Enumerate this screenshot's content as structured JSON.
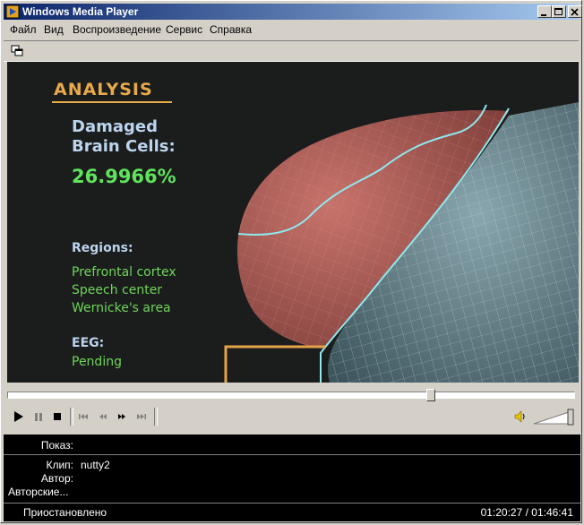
{
  "window": {
    "title": "Windows Media Player"
  },
  "menu": [
    "Файл",
    "Вид",
    "Воспроизведение",
    "Сервис",
    "Справка"
  ],
  "overlay": {
    "heading": "ANALYSIS",
    "damaged_line1": "Damaged",
    "damaged_line2": "Brain Cells:",
    "percentage": "26.9966%",
    "regions_label": "Regions:",
    "regions": [
      "Prefrontal cortex",
      "Speech center",
      "Wernicke's area"
    ],
    "eeg_label": "EEG:",
    "eeg_status": "Pending"
  },
  "seek": {
    "progress": 0.75
  },
  "volume": {
    "level": 1.0
  },
  "info": {
    "show_label": "Показ:",
    "show_value": "",
    "clip_label": "Клип:",
    "clip_value": "nutty2",
    "author_label": "Автор:",
    "author_value": "",
    "copyright_label": "Авторские...",
    "copyright_value": ""
  },
  "status": {
    "state": "Приостановлено",
    "time": "01:20:27 / 01:46:41"
  },
  "colors": {
    "title_gradient_start": "#0a246a",
    "title_gradient_end": "#a6caf0",
    "overlay_heading": "#e8a94a",
    "overlay_value": "#5fe35c",
    "brain_red": "#b8645e",
    "brain_blue": "#6a8790"
  },
  "icons": [
    "wmp-app-icon",
    "minimize-icon",
    "maximize-icon",
    "close-icon",
    "compact-mode-icon",
    "play-icon",
    "pause-icon",
    "stop-icon",
    "skip-back-icon",
    "rewind-icon",
    "fast-forward-icon",
    "skip-forward-icon",
    "speaker-icon"
  ]
}
